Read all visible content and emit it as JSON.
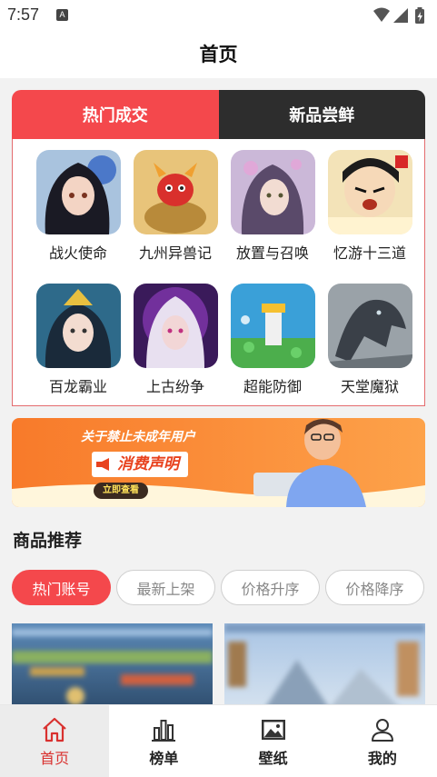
{
  "status_bar": {
    "time": "7:57",
    "notification_icon": "A"
  },
  "header": {
    "title": "首页"
  },
  "tabs": [
    {
      "label": "热门成交",
      "active": true
    },
    {
      "label": "新品尝鲜",
      "active": false
    }
  ],
  "games": [
    {
      "name": "战火使命"
    },
    {
      "name": "九州异兽记"
    },
    {
      "name": "放置与召唤"
    },
    {
      "name": "忆游十三道"
    },
    {
      "name": "百龙霸业"
    },
    {
      "name": "上古纷争"
    },
    {
      "name": "超能防御"
    },
    {
      "name": "天堂魔狱"
    }
  ],
  "banner": {
    "line1": "关于禁止未成年用户",
    "line2": "消费声明",
    "button": "立即查看"
  },
  "section": {
    "title": "商品推荐"
  },
  "filters": [
    {
      "label": "热门账号",
      "active": true
    },
    {
      "label": "最新上架",
      "active": false
    },
    {
      "label": "价格升序",
      "active": false
    },
    {
      "label": "价格降序",
      "active": false
    }
  ],
  "bottom_nav": [
    {
      "label": "首页",
      "icon": "home-icon",
      "active": true
    },
    {
      "label": "榜单",
      "icon": "chart-icon",
      "active": false
    },
    {
      "label": "壁纸",
      "icon": "image-icon",
      "active": false
    },
    {
      "label": "我的",
      "icon": "user-icon",
      "active": false
    }
  ],
  "colors": {
    "accent": "#f4484c",
    "dark_tab": "#2d2d2d",
    "nav_active": "#d9312f"
  }
}
